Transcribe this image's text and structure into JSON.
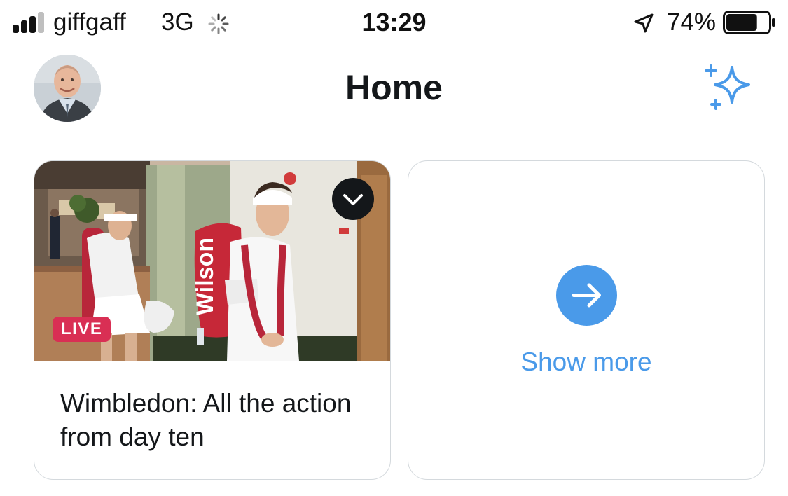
{
  "status_bar": {
    "carrier": "giffgaff",
    "network": "3G",
    "time": "13:29",
    "battery_percent": "74%",
    "signal_bars_active": 3,
    "signal_bars_total": 4,
    "battery_level": 0.74,
    "icons": [
      "signal-bars-icon",
      "activity-spinner-icon",
      "location-arrow-icon",
      "battery-icon"
    ]
  },
  "header": {
    "title": "Home",
    "avatar_icon": "profile-avatar",
    "action_icon": "sparkle-icon"
  },
  "cards": {
    "news": {
      "badge": "LIVE",
      "headline": "Wimbledon: All the action from day ten",
      "menu_icon": "chevron-down-icon",
      "image": "tennis-players-photo"
    },
    "more": {
      "label": "Show more",
      "icon": "arrow-right-icon"
    }
  },
  "colors": {
    "accent": "#4a9ae9",
    "live_badge": "#d92f54",
    "text": "#14171a",
    "divider": "#d3d6d9"
  }
}
